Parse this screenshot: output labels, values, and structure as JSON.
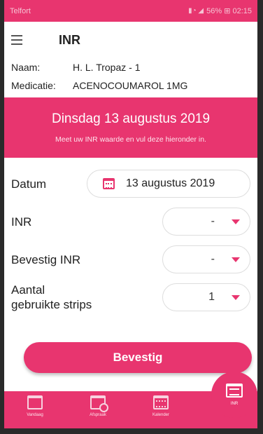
{
  "statusbar": {
    "carrier": "Telfort",
    "right_text": "56% ⊞ 02:15"
  },
  "appbar": {
    "title": "INR"
  },
  "patient": {
    "name_label": "Naam:",
    "name_value": "H. L. Tropaz - 1",
    "med_label": "Medicatie:",
    "med_value": "ACENOCOUMAROL 1MG"
  },
  "banner": {
    "date": "Dinsdag 13 augustus 2019",
    "instruction": "Meet uw INR waarde en vul deze hieronder in."
  },
  "form": {
    "date_label": "Datum",
    "date_value": "13 augustus 2019",
    "inr_label": "INR",
    "inr_value": "-",
    "confirm_inr_label": "Bevestig INR",
    "confirm_inr_value": "-",
    "strips_label_line1": "Aantal",
    "strips_label_line2": "gebruikte strips",
    "strips_value": "1"
  },
  "confirm_button": "Bevestig",
  "bottom_nav": {
    "items": [
      {
        "label": "Vandaag",
        "icon": "calendar-icon"
      },
      {
        "label": "Afspraak",
        "icon": "calendar-clock-icon"
      },
      {
        "label": "Kalender",
        "icon": "calendar-grid-icon"
      },
      {
        "label": "INR",
        "icon": "inr-icon"
      }
    ]
  },
  "colors": {
    "accent": "#e8356f"
  }
}
